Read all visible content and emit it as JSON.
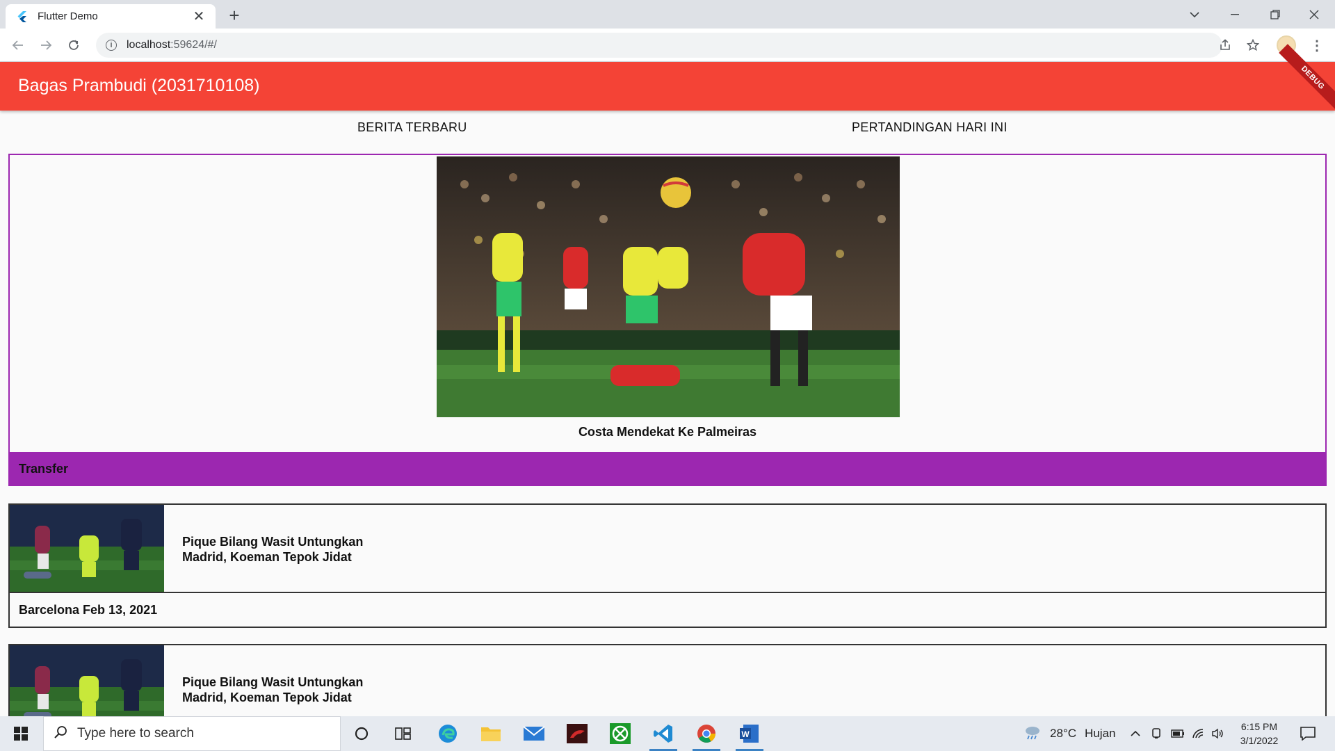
{
  "browser": {
    "tab_title": "Flutter Demo",
    "new_tab_label": "+",
    "url_host": "localhost",
    "url_rest": ":59624/#/"
  },
  "app": {
    "title": "Bagas Prambudi (2031710108)",
    "debug_banner": "DEBUG",
    "tabs": [
      {
        "label": "BERITA TERBARU"
      },
      {
        "label": "PERTANDINGAN HARI INI"
      }
    ],
    "featured": {
      "title": "Costa Mendekat Ke Palmeiras",
      "category": "Transfer"
    },
    "news": [
      {
        "title": "Pique Bilang Wasit Untungkan Madrid, Koeman Tepok Jidat",
        "meta": "Barcelona Feb 13, 2021"
      },
      {
        "title": "Pique Bilang Wasit Untungkan Madrid, Koeman Tepok Jidat",
        "meta": ""
      }
    ]
  },
  "taskbar": {
    "search_placeholder": "Type here to search",
    "weather_temp": "28°C",
    "weather_desc": "Hujan",
    "time": "6:15 PM",
    "date": "3/1/2022"
  },
  "colors": {
    "appbar": "#f44336",
    "featured_border": "#9c27b0",
    "category_bar": "#9c27b0"
  }
}
